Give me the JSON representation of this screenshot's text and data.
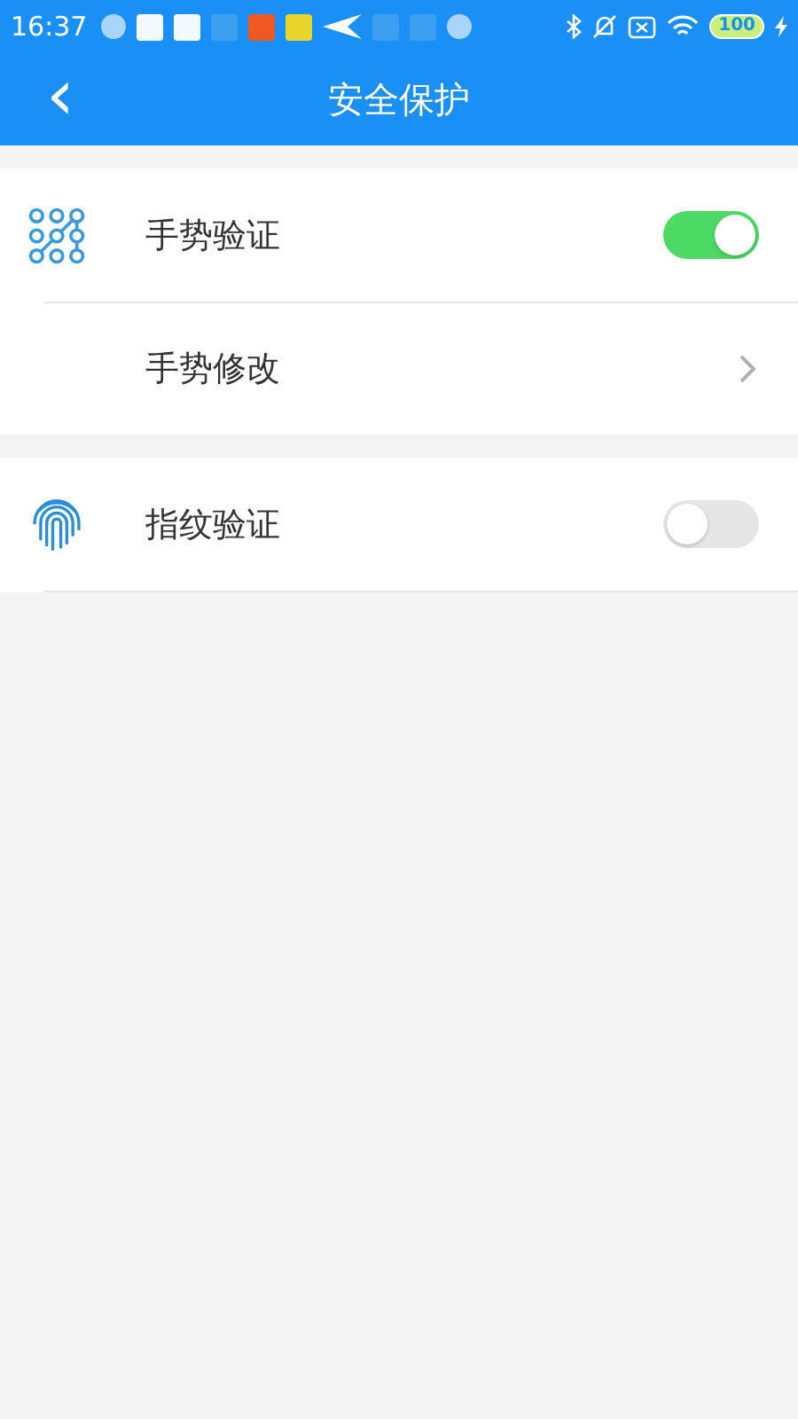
{
  "status_bar": {
    "time": "16:37",
    "battery": "100"
  },
  "header": {
    "back": "‹",
    "title": "安全保护"
  },
  "groups": [
    {
      "rows": [
        {
          "kind": "gesture",
          "label": "手势验证",
          "on": true
        },
        {
          "kind": "link",
          "label": "手势修改"
        }
      ]
    },
    {
      "rows": [
        {
          "kind": "fingerprint",
          "label": "指纹验证",
          "on": false
        }
      ]
    }
  ]
}
